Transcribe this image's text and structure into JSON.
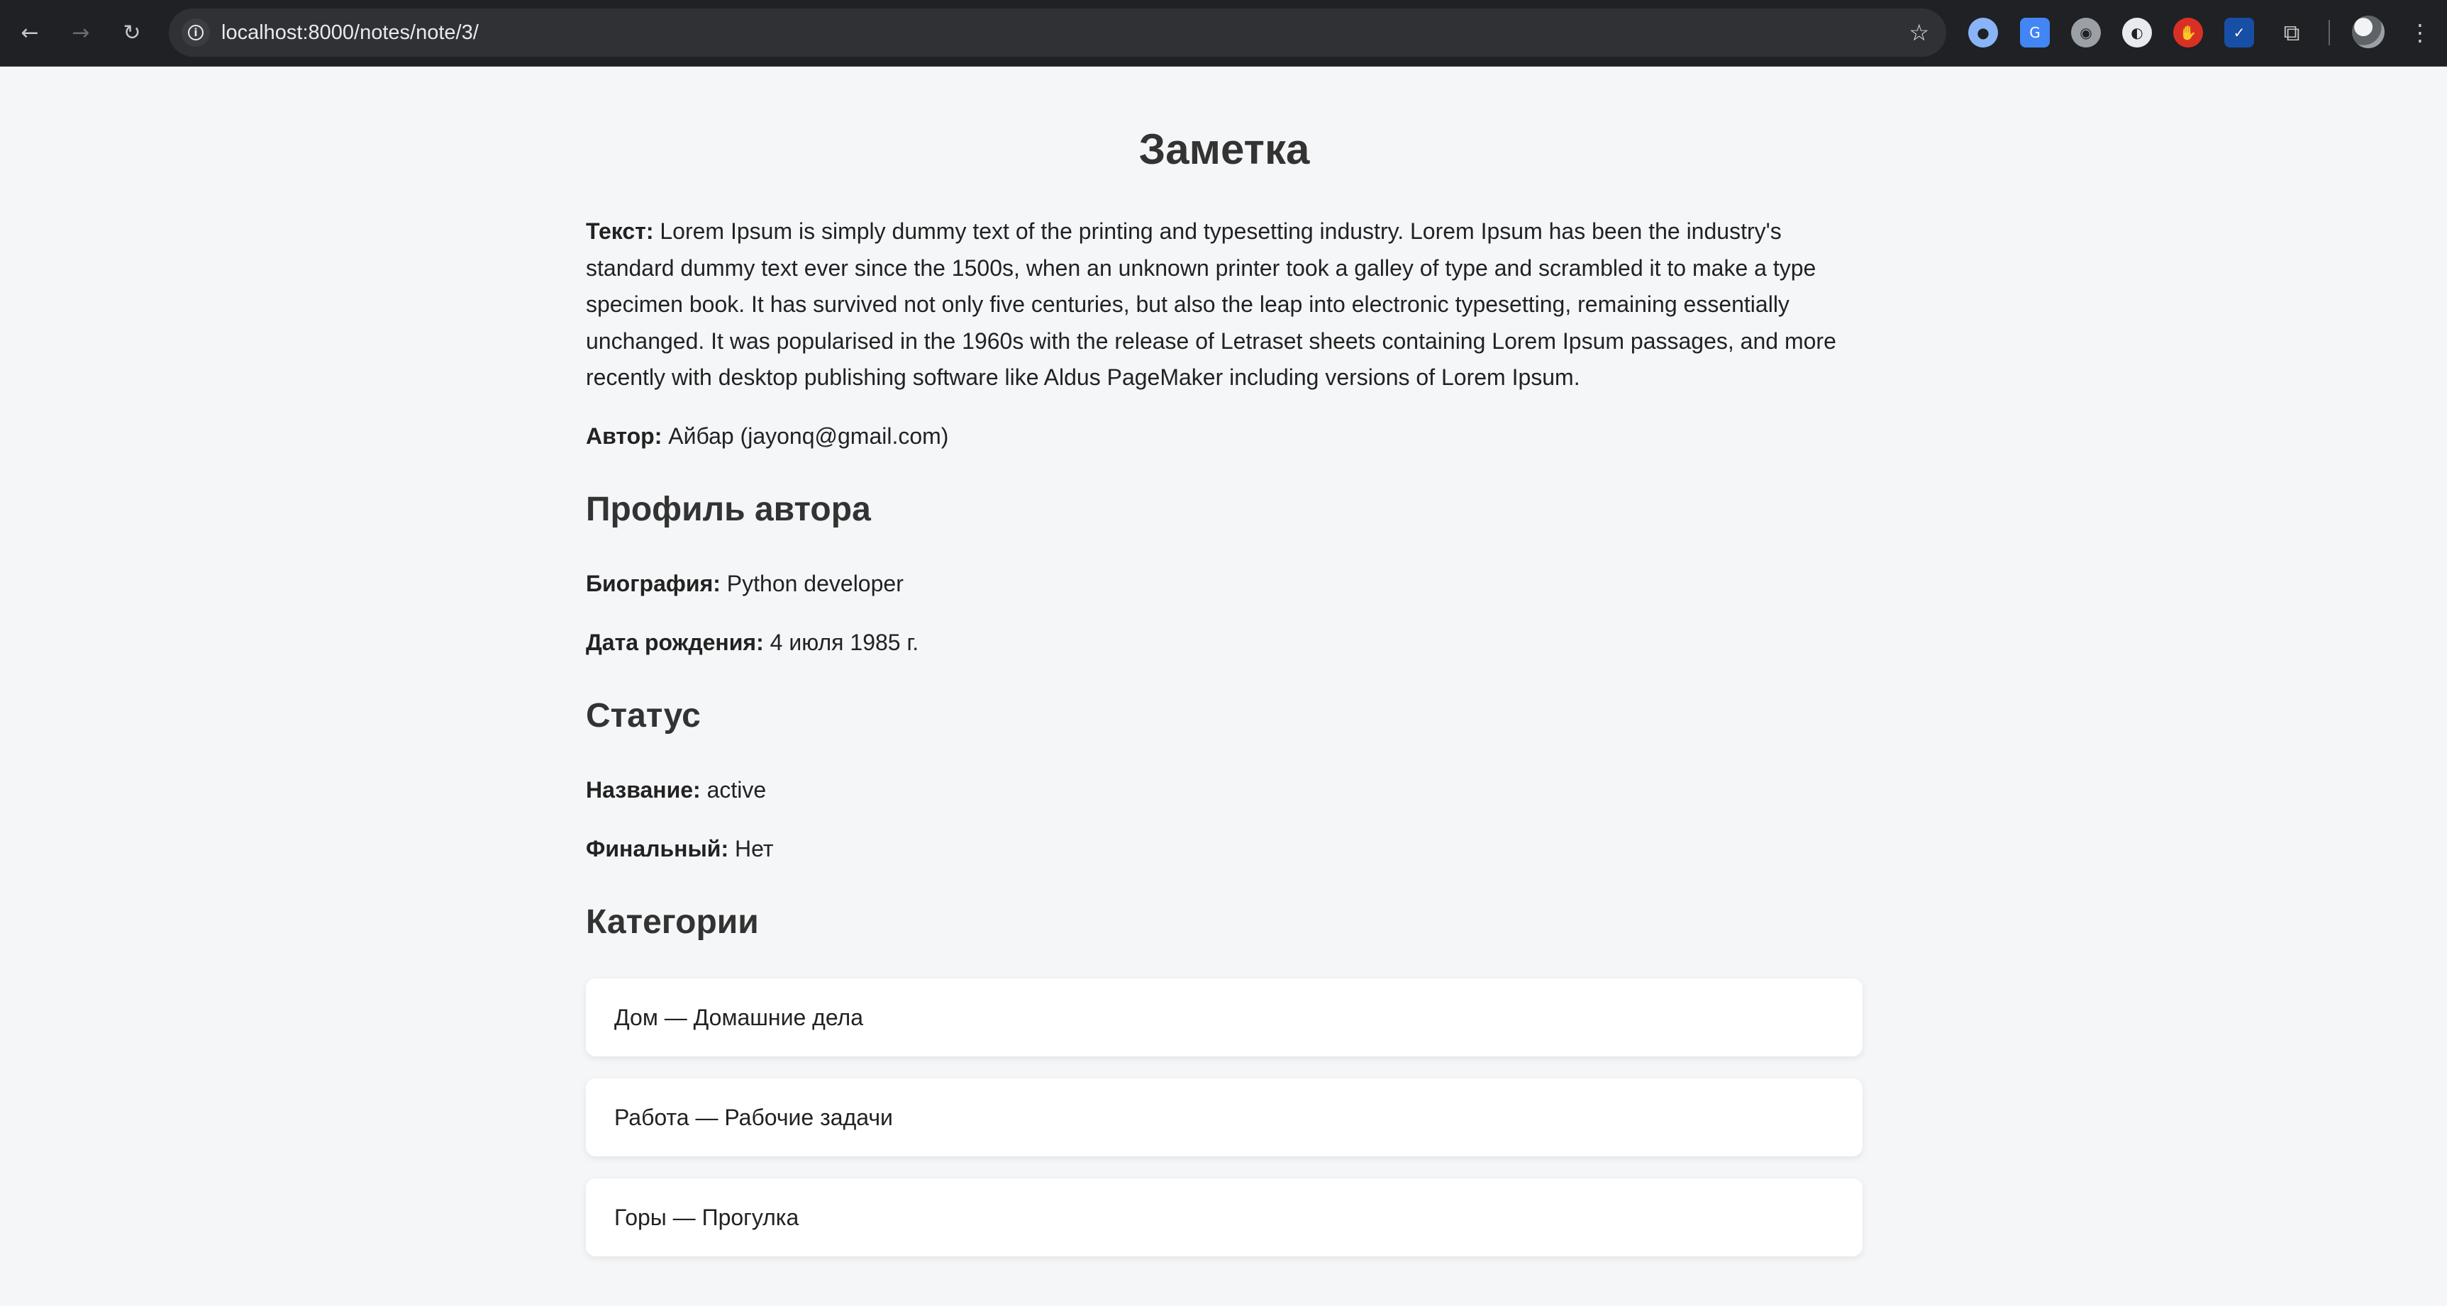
{
  "browser": {
    "url": "localhost:8000/notes/note/3/",
    "icons": {
      "back": "arrow-left-icon",
      "forward": "arrow-right-icon",
      "reload": "reload-icon",
      "info": "info-icon",
      "bookmark": "star-icon",
      "extensions": "puzzle-icon",
      "menu": "kebab-menu-icon"
    }
  },
  "page": {
    "title": "Заметка",
    "text_label": "Текст:",
    "text_value": "Lorem Ipsum is simply dummy text of the printing and typesetting industry. Lorem Ipsum has been the industry's standard dummy text ever since the 1500s, when an unknown printer took a galley of type and scrambled it to make a type specimen book. It has survived not only five centuries, but also the leap into electronic typesetting, remaining essentially unchanged. It was popularised in the 1960s with the release of Letraset sheets containing Lorem Ipsum passages, and more recently with desktop publishing software like Aldus PageMaker including versions of Lorem Ipsum.",
    "author_label": "Автор:",
    "author_value": "Айбар (jayonq@gmail.com)",
    "profile": {
      "heading": "Профиль автора",
      "bio_label": "Биография:",
      "bio_value": "Python developer",
      "birth_label": "Дата рождения:",
      "birth_value": "4 июля 1985 г."
    },
    "status": {
      "heading": "Статус",
      "name_label": "Название:",
      "name_value": "active",
      "final_label": "Финальный:",
      "final_value": "Нет"
    },
    "categories": {
      "heading": "Категории",
      "items": [
        "Дом — Домашние дела",
        "Работа — Рабочие задачи",
        "Горы — Прогулка"
      ]
    }
  },
  "colors": {
    "page_background": "#f5f6f8",
    "chrome_background": "#202124",
    "omnibox_background": "#303134",
    "card_background": "#ffffff"
  }
}
